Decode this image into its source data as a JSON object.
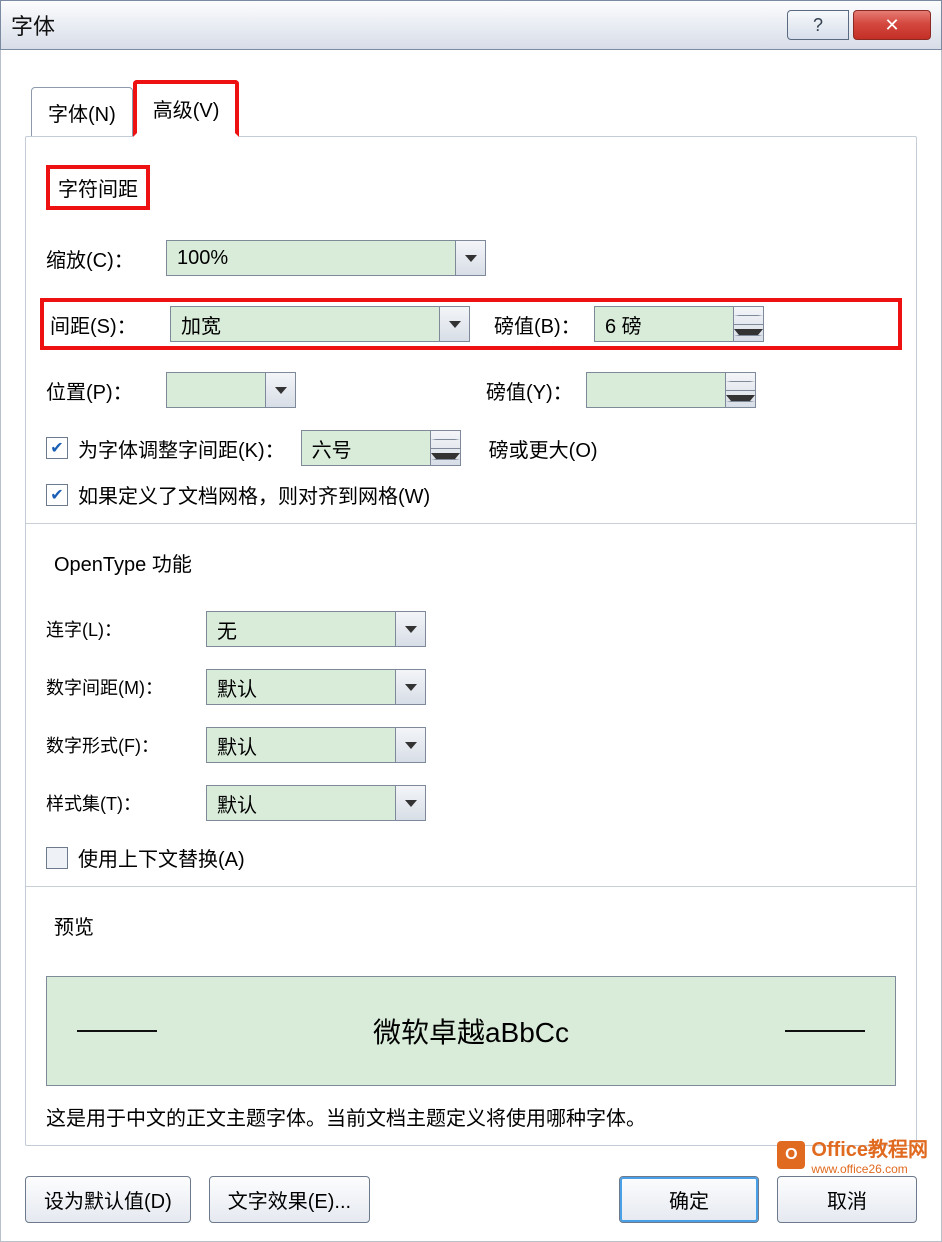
{
  "title": "字体",
  "tabs": {
    "font": "字体(N)",
    "advanced": "高级(V)"
  },
  "char_spacing": {
    "title": "字符间距",
    "scale_label": "缩放(C)：",
    "scale_value": "100%",
    "spacing_label": "间距(S)：",
    "spacing_value": "加宽",
    "by_label_b": "磅值(B)：",
    "by_value_b": "6 磅",
    "position_label": "位置(P)：",
    "position_value": "",
    "by_label_y": "磅值(Y)：",
    "by_value_y": "",
    "kerning_label": "为字体调整字间距(K)：",
    "kerning_value": "六号",
    "kerning_suffix": "磅或更大(O)",
    "snap_label": "如果定义了文档网格，则对齐到网格(W)"
  },
  "opentype": {
    "title": "OpenType 功能",
    "ligatures_label": "连字(L)：",
    "ligatures_value": "无",
    "num_spacing_label": "数字间距(M)：",
    "num_spacing_value": "默认",
    "num_form_label": "数字形式(F)：",
    "num_form_value": "默认",
    "style_set_label": "样式集(T)：",
    "style_set_value": "默认",
    "contextual_label": "使用上下文替换(A)"
  },
  "preview": {
    "title": "预览",
    "sample": "微软卓越aBbCc",
    "desc": "这是用于中文的正文主题字体。当前文档主题定义将使用哪种字体。"
  },
  "buttons": {
    "default": "设为默认值(D)",
    "effects": "文字效果(E)...",
    "ok": "确定",
    "cancel": "取消"
  },
  "watermark": {
    "name": "Office教程网",
    "url": "www.office26.com"
  }
}
